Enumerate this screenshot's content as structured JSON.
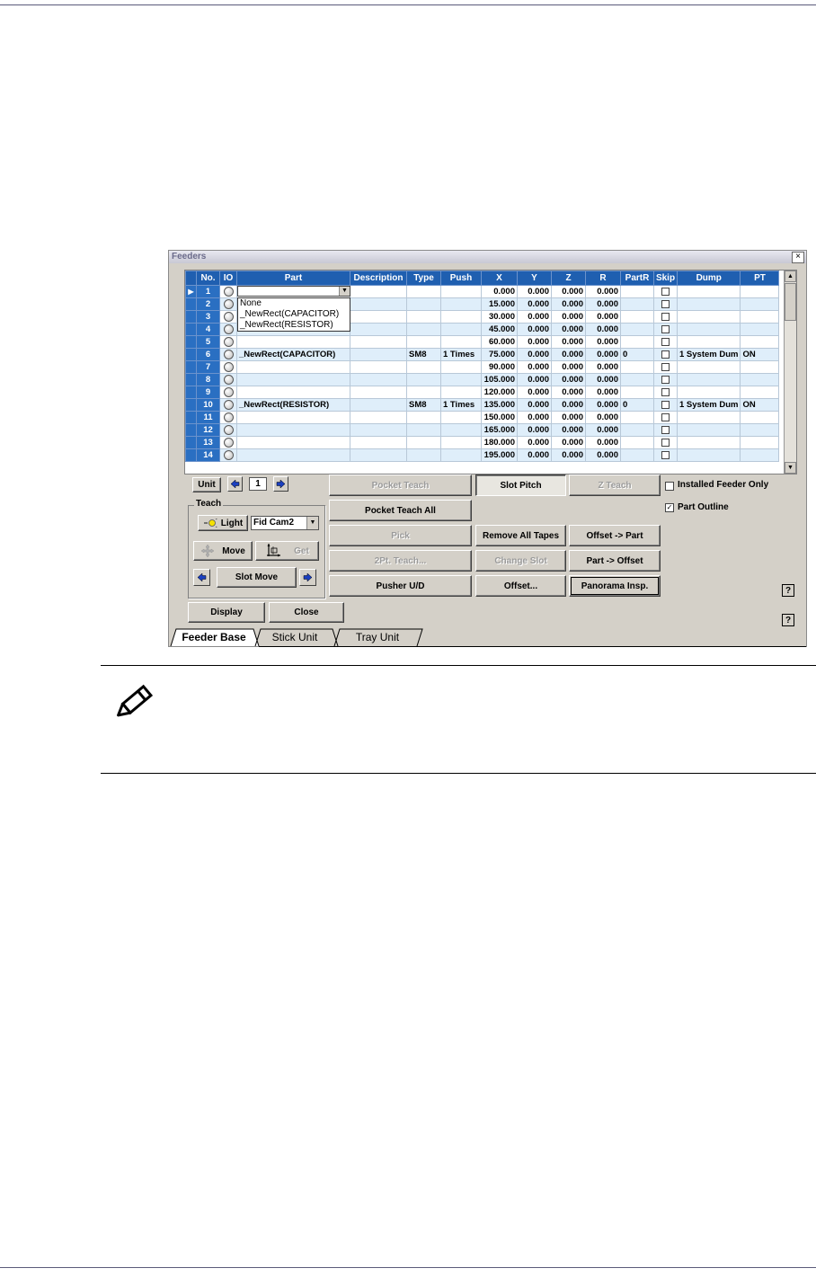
{
  "window": {
    "title": "Feeders",
    "close_glyph": "×"
  },
  "grid": {
    "columns": [
      "No.",
      "IO",
      "Part",
      "Description",
      "Type",
      "Push",
      "X",
      "Y",
      "Z",
      "R",
      "PartR",
      "Skip",
      "Dump",
      "PT"
    ],
    "rows": [
      {
        "no": "1",
        "part": "",
        "description": "",
        "type": "",
        "push": "",
        "x": "0.000",
        "y": "0.000",
        "z": "0.000",
        "r": "0.000",
        "partr": "",
        "dump": "",
        "pt": ""
      },
      {
        "no": "2",
        "part": "",
        "description": "",
        "type": "",
        "push": "",
        "x": "15.000",
        "y": "0.000",
        "z": "0.000",
        "r": "0.000",
        "partr": "",
        "dump": "",
        "pt": ""
      },
      {
        "no": "3",
        "part": "",
        "description": "",
        "type": "",
        "push": "",
        "x": "30.000",
        "y": "0.000",
        "z": "0.000",
        "r": "0.000",
        "partr": "",
        "dump": "",
        "pt": ""
      },
      {
        "no": "4",
        "part": "",
        "description": "",
        "type": "",
        "push": "",
        "x": "45.000",
        "y": "0.000",
        "z": "0.000",
        "r": "0.000",
        "partr": "",
        "dump": "",
        "pt": ""
      },
      {
        "no": "5",
        "part": "",
        "description": "",
        "type": "",
        "push": "",
        "x": "60.000",
        "y": "0.000",
        "z": "0.000",
        "r": "0.000",
        "partr": "",
        "dump": "",
        "pt": ""
      },
      {
        "no": "6",
        "part": "_NewRect(CAPACITOR)",
        "description": "",
        "type": "SM8",
        "push": "1 Times",
        "x": "75.000",
        "y": "0.000",
        "z": "0.000",
        "r": "0.000",
        "partr": "0",
        "dump": "1 System Dum",
        "pt": "ON"
      },
      {
        "no": "7",
        "part": "",
        "description": "",
        "type": "",
        "push": "",
        "x": "90.000",
        "y": "0.000",
        "z": "0.000",
        "r": "0.000",
        "partr": "",
        "dump": "",
        "pt": ""
      },
      {
        "no": "8",
        "part": "",
        "description": "",
        "type": "",
        "push": "",
        "x": "105.000",
        "y": "0.000",
        "z": "0.000",
        "r": "0.000",
        "partr": "",
        "dump": "",
        "pt": ""
      },
      {
        "no": "9",
        "part": "",
        "description": "",
        "type": "",
        "push": "",
        "x": "120.000",
        "y": "0.000",
        "z": "0.000",
        "r": "0.000",
        "partr": "",
        "dump": "",
        "pt": ""
      },
      {
        "no": "10",
        "part": "_NewRect(RESISTOR)",
        "description": "",
        "type": "SM8",
        "push": "1 Times",
        "x": "135.000",
        "y": "0.000",
        "z": "0.000",
        "r": "0.000",
        "partr": "0",
        "dump": "1 System Dum",
        "pt": "ON"
      },
      {
        "no": "11",
        "part": "",
        "description": "",
        "type": "",
        "push": "",
        "x": "150.000",
        "y": "0.000",
        "z": "0.000",
        "r": "0.000",
        "partr": "",
        "dump": "",
        "pt": ""
      },
      {
        "no": "12",
        "part": "",
        "description": "",
        "type": "",
        "push": "",
        "x": "165.000",
        "y": "0.000",
        "z": "0.000",
        "r": "0.000",
        "partr": "",
        "dump": "",
        "pt": ""
      },
      {
        "no": "13",
        "part": "",
        "description": "",
        "type": "",
        "push": "",
        "x": "180.000",
        "y": "0.000",
        "z": "0.000",
        "r": "0.000",
        "partr": "",
        "dump": "",
        "pt": ""
      },
      {
        "no": "14",
        "part": "",
        "description": "",
        "type": "",
        "push": "",
        "x": "195.000",
        "y": "0.000",
        "z": "0.000",
        "r": "0.000",
        "partr": "",
        "dump": "",
        "pt": ""
      }
    ],
    "current_row_indicator": "▶",
    "part_dropdown": {
      "options": [
        "None",
        "_NewRect(CAPACITOR)",
        "_NewRect(RESISTOR)"
      ]
    }
  },
  "controls": {
    "unit_label": "Unit",
    "unit_value": "1",
    "teach_label": "Teach",
    "light_label": "Light",
    "camera_value": "Fid Cam2",
    "move_label": "Move",
    "get_label": "Get",
    "slot_move_label": "Slot Move",
    "display_label": "Display",
    "close_label": "Close",
    "pocket_teach_label": "Pocket Teach",
    "slot_pitch_label": "Slot Pitch",
    "z_teach_label": "Z Teach",
    "pocket_teach_all_label": "Pocket Teach All",
    "pick_label": "Pick",
    "remove_all_tapes_label": "Remove All Tapes",
    "offset_to_part_label": "Offset -> Part",
    "two_pt_teach_label": "2Pt. Teach...",
    "change_slot_label": "Change Slot",
    "part_to_offset_label": "Part -> Offset",
    "pusher_label": "Pusher U/D",
    "offset_label": "Offset...",
    "panorama_label": "Panorama Insp.",
    "installed_feeder_only_label": "Installed Feeder Only",
    "installed_feeder_only_checked": false,
    "part_outline_label": "Part Outline",
    "part_outline_checked": true,
    "help_glyph": "?"
  },
  "tabs": [
    "Feeder Base",
    "Stick Unit",
    "Tray Unit"
  ],
  "active_tab": "Feeder Base"
}
